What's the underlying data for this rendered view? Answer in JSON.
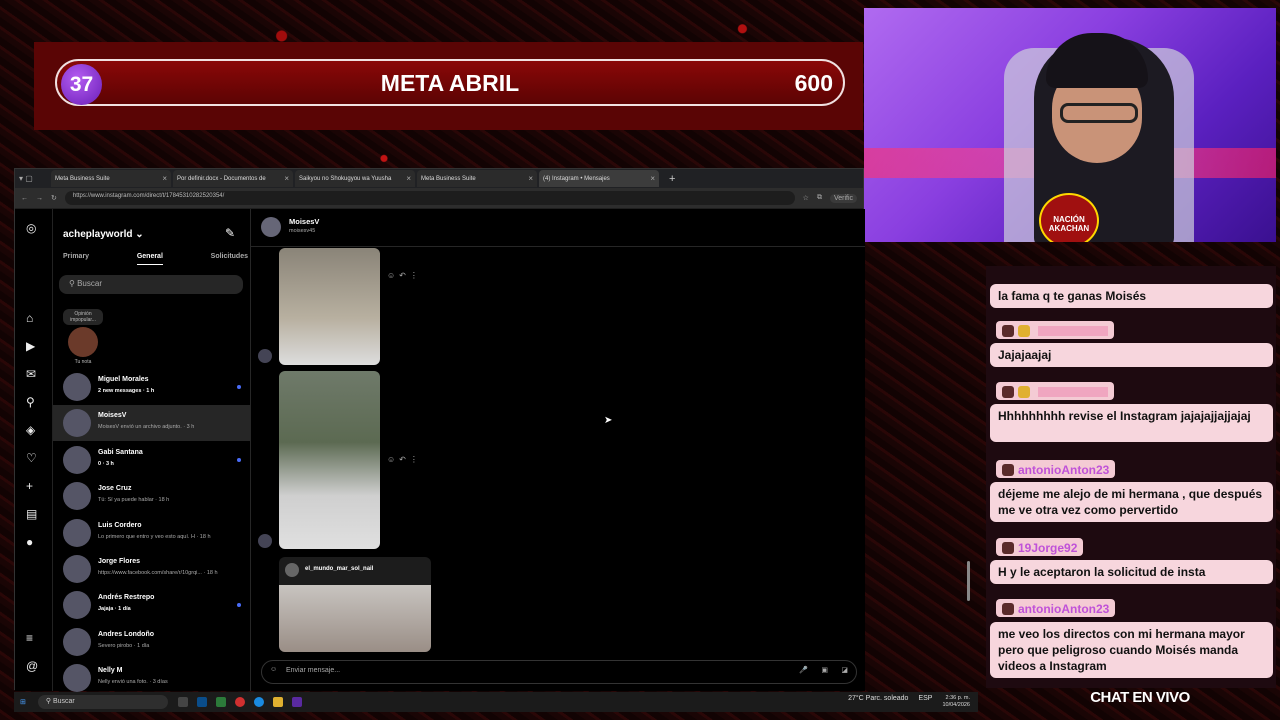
{
  "overlay": {
    "meta_number": "37",
    "meta_title": "META ABRIL",
    "meta_goal": "600",
    "chat_label": "CHAT EN VIVO",
    "cam_logo": "NACIÓN AKACHAN"
  },
  "chat": [
    {
      "text": "la fama q te ganas Moisés"
    },
    {
      "user": "",
      "text": "Jajajaajaj"
    },
    {
      "user": "",
      "text": "Hhhhhhhhh revise el Instagram jajajajjajjajaj"
    },
    {
      "user": "antonioAnton23",
      "text": "déjeme me alejo de mi hermana , que después me ve otra vez como pervertido"
    },
    {
      "user": "19Jorge92",
      "text": "H y le aceptaron la solicitud de insta"
    },
    {
      "user": "antonioAnton23",
      "text": "me veo los directos con mi hermana mayor pero que peligroso cuando Moisés manda videos a Instagram"
    }
  ],
  "browser": {
    "tabs": [
      {
        "label": "Meta Business Suite"
      },
      {
        "label": "Por definir.docx - Documentos de"
      },
      {
        "label": "Saikyou no Shokugyou wa Yuusha"
      },
      {
        "label": "Meta Business Suite"
      },
      {
        "label": "(4) Instagram • Mensajes"
      }
    ],
    "url": "https://www.instagram.com/direct/t/17845310282520354/",
    "verify": "Verific"
  },
  "ig": {
    "account": "acheplayworld ⌄",
    "tabs": [
      "Primary",
      "General",
      "Solicitudes"
    ],
    "search_placeholder": "Buscar",
    "note_bubble": "Opinión impopular...",
    "note_label": "Tu nota",
    "dms": [
      {
        "name": "Miguel Morales",
        "preview": "2 new messages · 1 h",
        "unread": true
      },
      {
        "name": "MoisesV",
        "preview": "MoisesV envió un archivo adjunto. · 3 h",
        "unread": false
      },
      {
        "name": "Gabi Santana",
        "preview": "0 · 3 h",
        "unread": true
      },
      {
        "name": "Jose Cruz",
        "preview": "Tú: Sí ya puede hablar · 18 h",
        "unread": false
      },
      {
        "name": "Luis Cordero",
        "preview": "Lo primero que entro y veo esto aquí. H · 18 h",
        "unread": false
      },
      {
        "name": "Jorge Flores",
        "preview": "https://www.facebook.com/share/r/10grqi... · 18 h",
        "unread": false
      },
      {
        "name": "Andrés Restrepo",
        "preview": "Jajaja · 1 día",
        "unread": true
      },
      {
        "name": "Andres Londoño",
        "preview": "Severo pirobo · 1 día",
        "unread": false
      },
      {
        "name": "Nelly M",
        "preview": "Nelly envió una foto. · 3 días",
        "unread": false
      }
    ],
    "conversation": {
      "name": "MoisesV",
      "username": "moisesv45",
      "shared_post_user": "el_mundo_mar_sol_nail",
      "composer_placeholder": "Enviar mensaje..."
    }
  },
  "taskbar": {
    "search": "Buscar",
    "weather": "27°C  Parc. soleado",
    "lang": "ESP",
    "time": "2:36 p. m.",
    "date": "10/04/2026"
  }
}
